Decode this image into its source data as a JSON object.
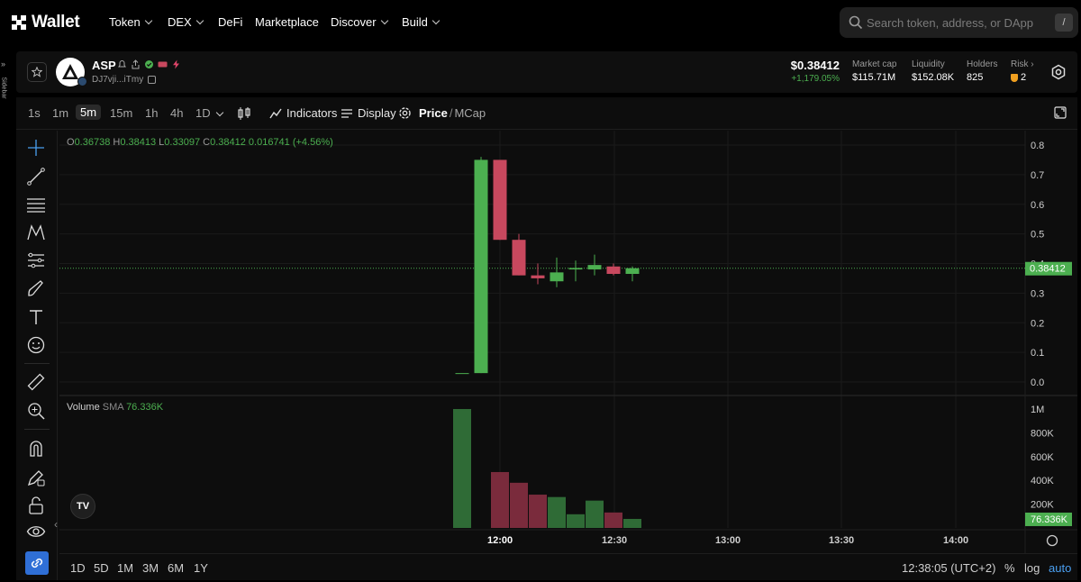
{
  "nav": {
    "logo": "Wallet",
    "items": [
      {
        "label": "Token",
        "dropdown": true
      },
      {
        "label": "DEX",
        "dropdown": true
      },
      {
        "label": "DeFi",
        "dropdown": false
      },
      {
        "label": "Marketplace",
        "dropdown": false
      },
      {
        "label": "Discover",
        "dropdown": true
      },
      {
        "label": "Build",
        "dropdown": true
      }
    ],
    "search_placeholder": "Search token, address, or DApp",
    "search_shortcut": "/"
  },
  "sidebar": {
    "label": "Sidebar"
  },
  "token": {
    "symbol": "ASP",
    "address": "DJ7vji...iTmy",
    "price": "$0.38412",
    "change": "+1,179.05%",
    "stats": [
      {
        "label": "Market cap",
        "value": "$115.71M"
      },
      {
        "label": "Liquidity",
        "value": "$152.08K"
      },
      {
        "label": "Holders",
        "value": "825"
      }
    ],
    "risk_label": "Risk",
    "risk_value": "2"
  },
  "toolbar": {
    "timeframes": [
      "1s",
      "1m",
      "5m",
      "15m",
      "1h",
      "4h",
      "1D"
    ],
    "active_timeframe": "5m",
    "indicators": "Indicators",
    "display": "Display",
    "price": "Price",
    "sep": "/",
    "mcap": "MCap"
  },
  "legend": {
    "o_label": "O",
    "o": "0.36738",
    "h_label": "H",
    "h": "0.38413",
    "l_label": "L",
    "l": "0.33097",
    "c_label": "C",
    "c": "0.38412",
    "change": "0.016741 (+4.56%)",
    "volume_label": "Volume",
    "sma_label": "SMA",
    "sma_value": "76.336K"
  },
  "colors": {
    "up": "#4caf50",
    "down": "#c8485e",
    "background": "#0d0d0d",
    "accent": "#4a9ff0"
  },
  "chart_data": {
    "type": "candlestick",
    "price_axis": {
      "ticks": [
        "0.8",
        "0.7",
        "0.6",
        "0.5",
        "0.4",
        "0.3",
        "0.2",
        "0.1",
        "0.0"
      ],
      "range": [
        0,
        0.8
      ],
      "current": "0.38412"
    },
    "volume_axis": {
      "ticks": [
        "1M",
        "800K",
        "600K",
        "400K",
        "200K"
      ],
      "range": [
        0,
        1000000
      ],
      "current": "76.336K"
    },
    "time_ticks": [
      "12:00",
      "12:30",
      "13:00",
      "13:30",
      "14:00"
    ],
    "candles": [
      {
        "o": 0.03,
        "h": 0.03,
        "l": 0.03,
        "c": 0.03
      },
      {
        "o": 0.03,
        "h": 0.76,
        "l": 0.03,
        "c": 0.75
      },
      {
        "o": 0.75,
        "h": 0.75,
        "l": 0.48,
        "c": 0.48
      },
      {
        "o": 0.48,
        "h": 0.5,
        "l": 0.36,
        "c": 0.36
      },
      {
        "o": 0.36,
        "h": 0.4,
        "l": 0.33,
        "c": 0.35
      },
      {
        "o": 0.34,
        "h": 0.42,
        "l": 0.32,
        "c": 0.37
      },
      {
        "o": 0.38,
        "h": 0.41,
        "l": 0.34,
        "c": 0.385
      },
      {
        "o": 0.38,
        "h": 0.43,
        "l": 0.36,
        "c": 0.395
      },
      {
        "o": 0.39,
        "h": 0.4,
        "l": 0.36,
        "c": 0.365
      },
      {
        "o": 0.365,
        "h": 0.39,
        "l": 0.34,
        "c": 0.38412
      }
    ],
    "volumes": [
      1000000,
      0,
      470000,
      380000,
      280000,
      260000,
      115000,
      230000,
      130000,
      76000
    ],
    "volume_up": [
      true,
      true,
      false,
      false,
      false,
      true,
      true,
      true,
      false,
      true
    ]
  },
  "bottom": {
    "ranges": [
      "1D",
      "5D",
      "1M",
      "3M",
      "6M",
      "1Y"
    ],
    "time": "12:38:05 (UTC+2)",
    "percent": "%",
    "log": "log",
    "auto": "auto"
  }
}
